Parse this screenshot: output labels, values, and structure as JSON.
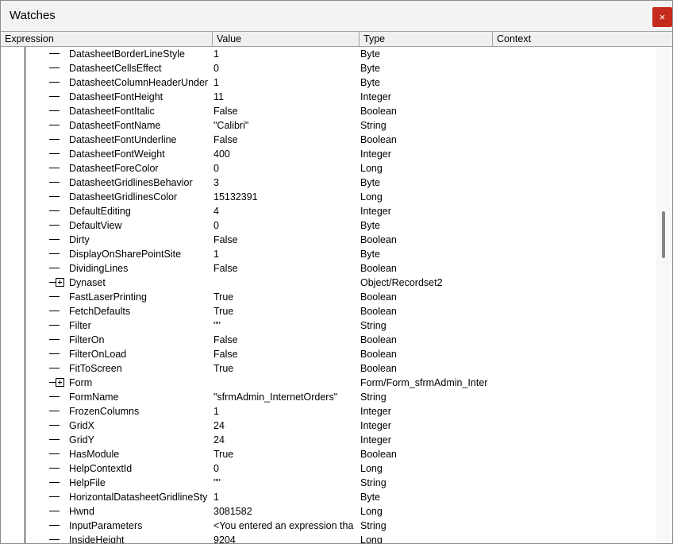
{
  "window": {
    "title": "Watches",
    "close_label": "×"
  },
  "columns": {
    "expression": "Expression",
    "value": "Value",
    "type": "Type",
    "context": "Context"
  },
  "rows": [
    {
      "expr": "DatasheetBorderLineStyle",
      "value": "1",
      "type": "Byte",
      "context": "",
      "expandable": false
    },
    {
      "expr": "DatasheetCellsEffect",
      "value": "0",
      "type": "Byte",
      "context": "",
      "expandable": false
    },
    {
      "expr": "DatasheetColumnHeaderUnder",
      "value": "1",
      "type": "Byte",
      "context": "",
      "expandable": false
    },
    {
      "expr": "DatasheetFontHeight",
      "value": "11",
      "type": "Integer",
      "context": "",
      "expandable": false
    },
    {
      "expr": "DatasheetFontItalic",
      "value": "False",
      "type": "Boolean",
      "context": "",
      "expandable": false
    },
    {
      "expr": "DatasheetFontName",
      "value": "\"Calibri\"",
      "type": "String",
      "context": "",
      "expandable": false
    },
    {
      "expr": "DatasheetFontUnderline",
      "value": "False",
      "type": "Boolean",
      "context": "",
      "expandable": false
    },
    {
      "expr": "DatasheetFontWeight",
      "value": "400",
      "type": "Integer",
      "context": "",
      "expandable": false
    },
    {
      "expr": "DatasheetForeColor",
      "value": "0",
      "type": "Long",
      "context": "",
      "expandable": false
    },
    {
      "expr": "DatasheetGridlinesBehavior",
      "value": "3",
      "type": "Byte",
      "context": "",
      "expandable": false
    },
    {
      "expr": "DatasheetGridlinesColor",
      "value": "15132391",
      "type": "Long",
      "context": "",
      "expandable": false
    },
    {
      "expr": "DefaultEditing",
      "value": "4",
      "type": "Integer",
      "context": "",
      "expandable": false
    },
    {
      "expr": "DefaultView",
      "value": "0",
      "type": "Byte",
      "context": "",
      "expandable": false
    },
    {
      "expr": "Dirty",
      "value": "False",
      "type": "Boolean",
      "context": "",
      "expandable": false
    },
    {
      "expr": "DisplayOnSharePointSite",
      "value": "1",
      "type": "Byte",
      "context": "",
      "expandable": false
    },
    {
      "expr": "DividingLines",
      "value": "False",
      "type": "Boolean",
      "context": "",
      "expandable": false
    },
    {
      "expr": "Dynaset",
      "value": "",
      "type": "Object/Recordset2",
      "context": "",
      "expandable": true
    },
    {
      "expr": "FastLaserPrinting",
      "value": "True",
      "type": "Boolean",
      "context": "",
      "expandable": false
    },
    {
      "expr": "FetchDefaults",
      "value": "True",
      "type": "Boolean",
      "context": "",
      "expandable": false
    },
    {
      "expr": "Filter",
      "value": "\"\"",
      "type": "String",
      "context": "",
      "expandable": false
    },
    {
      "expr": "FilterOn",
      "value": "False",
      "type": "Boolean",
      "context": "",
      "expandable": false
    },
    {
      "expr": "FilterOnLoad",
      "value": "False",
      "type": "Boolean",
      "context": "",
      "expandable": false
    },
    {
      "expr": "FitToScreen",
      "value": "True",
      "type": "Boolean",
      "context": "",
      "expandable": false
    },
    {
      "expr": "Form",
      "value": "",
      "type": "Form/Form_sfrmAdmin_Inter",
      "context": "",
      "expandable": true
    },
    {
      "expr": "FormName",
      "value": "\"sfrmAdmin_InternetOrders\"",
      "type": "String",
      "context": "",
      "expandable": false
    },
    {
      "expr": "FrozenColumns",
      "value": "1",
      "type": "Integer",
      "context": "",
      "expandable": false
    },
    {
      "expr": "GridX",
      "value": "24",
      "type": "Integer",
      "context": "",
      "expandable": false
    },
    {
      "expr": "GridY",
      "value": "24",
      "type": "Integer",
      "context": "",
      "expandable": false
    },
    {
      "expr": "HasModule",
      "value": "True",
      "type": "Boolean",
      "context": "",
      "expandable": false
    },
    {
      "expr": "HelpContextId",
      "value": "0",
      "type": "Long",
      "context": "",
      "expandable": false
    },
    {
      "expr": "HelpFile",
      "value": "\"\"",
      "type": "String",
      "context": "",
      "expandable": false
    },
    {
      "expr": "HorizontalDatasheetGridlineSty",
      "value": "1",
      "type": "Byte",
      "context": "",
      "expandable": false
    },
    {
      "expr": "Hwnd",
      "value": "3081582",
      "type": "Long",
      "context": "",
      "expandable": false
    },
    {
      "expr": "InputParameters",
      "value": "<You entered an expression tha",
      "type": "String",
      "context": "",
      "expandable": false
    },
    {
      "expr": "InsideHeight",
      "value": "9204",
      "type": "Long",
      "context": "",
      "expandable": false
    }
  ],
  "scroll": {
    "position_fraction": 0.33
  }
}
